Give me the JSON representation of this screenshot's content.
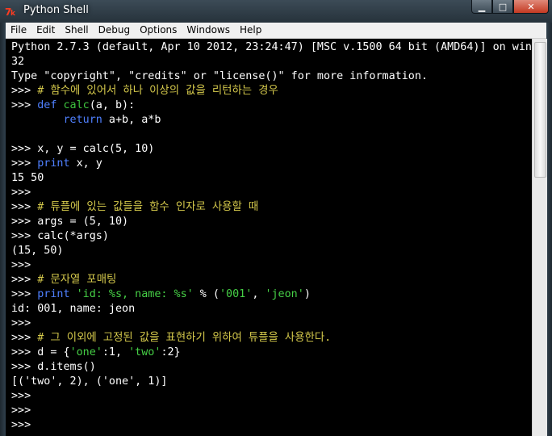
{
  "window": {
    "title": "Python Shell",
    "buttons": [
      "minimize",
      "maximize",
      "close"
    ]
  },
  "menu": [
    "File",
    "Edit",
    "Shell",
    "Debug",
    "Options",
    "Windows",
    "Help"
  ],
  "shell_lines": [
    [
      {
        "t": "text",
        "v": "Python 2.7.3 (default, Apr 10 2012, 23:24:47) [MSC v.1500 64 bit (AMD64)] on win"
      }
    ],
    [
      {
        "t": "text",
        "v": "32"
      }
    ],
    [
      {
        "t": "text",
        "v": "Type \"copyright\", \"credits\" or \"license()\" for more information."
      }
    ],
    [
      {
        "t": "prompt",
        "v": ">>> "
      },
      {
        "t": "comment",
        "v": "# 함수에 있어서 하나 이상의 값을 리턴하는 경우"
      }
    ],
    [
      {
        "t": "prompt",
        "v": ">>> "
      },
      {
        "t": "keyword",
        "v": "def "
      },
      {
        "t": "funcname",
        "v": "calc"
      },
      {
        "t": "text",
        "v": "(a, b):"
      }
    ],
    [
      {
        "t": "text",
        "v": "\t"
      },
      {
        "t": "keyword",
        "v": "return"
      },
      {
        "t": "text",
        "v": " a+b, a*b"
      }
    ],
    [
      {
        "t": "text",
        "v": ""
      }
    ],
    [
      {
        "t": "prompt",
        "v": ">>> "
      },
      {
        "t": "text",
        "v": "x, y = calc(5, 10)"
      }
    ],
    [
      {
        "t": "prompt",
        "v": ">>> "
      },
      {
        "t": "keyword",
        "v": "print"
      },
      {
        "t": "text",
        "v": " x, y"
      }
    ],
    [
      {
        "t": "text",
        "v": "15 50"
      }
    ],
    [
      {
        "t": "prompt",
        "v": ">>> "
      }
    ],
    [
      {
        "t": "prompt",
        "v": ">>> "
      },
      {
        "t": "comment",
        "v": "# 튜플에 있는 값들을 함수 인자로 사용할 때"
      }
    ],
    [
      {
        "t": "prompt",
        "v": ">>> "
      },
      {
        "t": "text",
        "v": "args = (5, 10)"
      }
    ],
    [
      {
        "t": "prompt",
        "v": ">>> "
      },
      {
        "t": "text",
        "v": "calc(*args)"
      }
    ],
    [
      {
        "t": "text",
        "v": "(15, 50)"
      }
    ],
    [
      {
        "t": "prompt",
        "v": ">>> "
      }
    ],
    [
      {
        "t": "prompt",
        "v": ">>> "
      },
      {
        "t": "comment",
        "v": "# 문자열 포매팅"
      }
    ],
    [
      {
        "t": "prompt",
        "v": ">>> "
      },
      {
        "t": "keyword",
        "v": "print"
      },
      {
        "t": "text",
        "v": " "
      },
      {
        "t": "string",
        "v": "'id: %s, name: %s'"
      },
      {
        "t": "text",
        "v": " % ("
      },
      {
        "t": "string",
        "v": "'001'"
      },
      {
        "t": "text",
        "v": ", "
      },
      {
        "t": "string",
        "v": "'jeon'"
      },
      {
        "t": "text",
        "v": ")"
      }
    ],
    [
      {
        "t": "text",
        "v": "id: 001, name: jeon"
      }
    ],
    [
      {
        "t": "prompt",
        "v": ">>> "
      }
    ],
    [
      {
        "t": "prompt",
        "v": ">>> "
      },
      {
        "t": "comment",
        "v": "# 그 이외에 고정된 값을 표현하기 위하여 튜플을 사용한다."
      }
    ],
    [
      {
        "t": "prompt",
        "v": ">>> "
      },
      {
        "t": "text",
        "v": "d = {"
      },
      {
        "t": "string",
        "v": "'one'"
      },
      {
        "t": "text",
        "v": ":1, "
      },
      {
        "t": "string",
        "v": "'two'"
      },
      {
        "t": "text",
        "v": ":2}"
      }
    ],
    [
      {
        "t": "prompt",
        "v": ">>> "
      },
      {
        "t": "text",
        "v": "d.items()"
      }
    ],
    [
      {
        "t": "text",
        "v": "[('two', 2), ('one', 1)]"
      }
    ],
    [
      {
        "t": "prompt",
        "v": ">>> "
      }
    ],
    [
      {
        "t": "prompt",
        "v": ">>> "
      }
    ],
    [
      {
        "t": "prompt",
        "v": ">>> "
      }
    ]
  ]
}
